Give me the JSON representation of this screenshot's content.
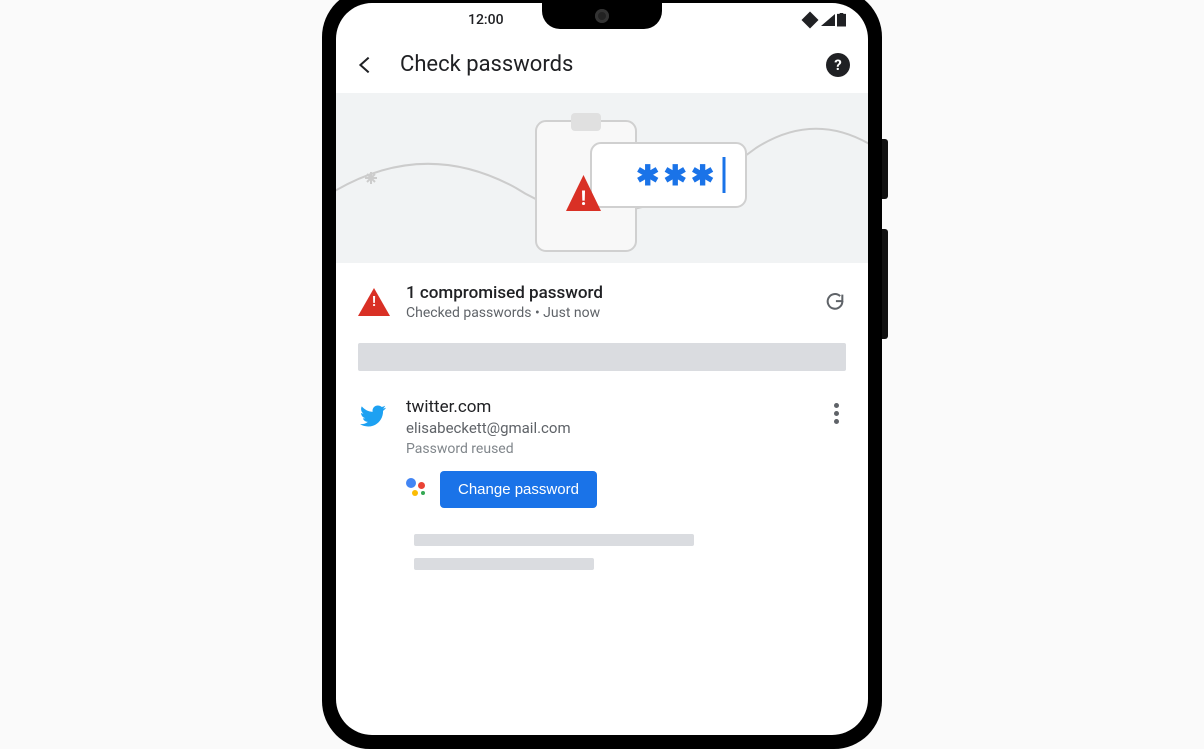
{
  "status": {
    "time": "12:00"
  },
  "appbar": {
    "title": "Check passwords"
  },
  "hero": {
    "masked_text": "✱✱✱ |"
  },
  "summary": {
    "title": "1 compromised password",
    "subtitle": "Checked passwords • Just now"
  },
  "entry": {
    "site": "twitter.com",
    "email": "elisabeckett@gmail.com",
    "status": "Password reused",
    "action_label": "Change password"
  }
}
